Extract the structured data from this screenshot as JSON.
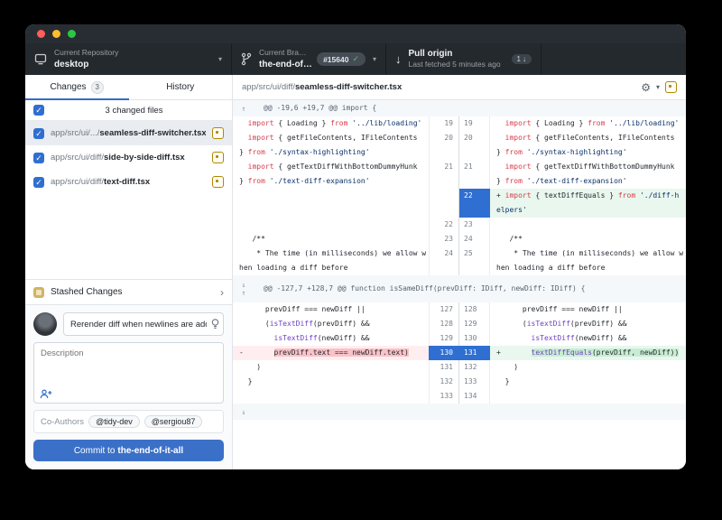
{
  "icons": {
    "caret": "▾",
    "check": "✓",
    "chevron_right": "›",
    "gear": "⚙",
    "arrow_down": "↓",
    "arrow_up": "↑",
    "checkmark": "✓"
  },
  "colors": {
    "accent_blue": "#316dca",
    "toolbar_bg": "#24292e",
    "selected_gutter": "#2f6fd1",
    "added_bg": "#e9f7ee",
    "removed_bg": "#ffeef0",
    "modified_icon": "#b08800",
    "keyword": "#d73a49",
    "string": "#0a3069",
    "function": "#6f42c1"
  },
  "toolbar": {
    "repo": {
      "label": "Current Repository",
      "value": "desktop"
    },
    "branch": {
      "label": "Current Bra…",
      "value": "the-end-of…",
      "badge": "#15640"
    },
    "pull": {
      "title": "Pull origin",
      "subtitle": "Last fetched 5 minutes ago",
      "badge_count": "1"
    }
  },
  "sidebar": {
    "tabs": {
      "changes": "Changes",
      "changes_badge": "3",
      "history": "History"
    },
    "files_header": "3 changed files",
    "files": [
      {
        "prefix": "app/src/ui/.../",
        "name": "seamless-diff-switcher.tsx",
        "selected": true
      },
      {
        "prefix": "app/src/ui/diff/",
        "name": "side-by-side-diff.tsx",
        "selected": false
      },
      {
        "prefix": "app/src/ui/diff/",
        "name": "text-diff.tsx",
        "selected": false
      }
    ],
    "stashed": "Stashed Changes",
    "commit": {
      "summary_value": "Rerender diff when newlines are adde",
      "description_placeholder": "Description",
      "coauthors_label": "Co-Authors",
      "coauthors": [
        "@tidy-dev",
        "@sergiou87"
      ],
      "button_prefix": "Commit to ",
      "button_branch": "the-end-of-it-all"
    }
  },
  "diff": {
    "file_prefix": "app/src/ui/diff/",
    "file_name": "seamless-diff-switcher.tsx",
    "rows": [
      {
        "type": "hunk",
        "icons": [
          "up"
        ],
        "text": "@@ -19,6 +19,7 @@ import {"
      },
      {
        "type": "line",
        "l": {
          "num": "19",
          "segs": [
            {
              "t": "  "
            },
            {
              "t": "import",
              "c": "k"
            },
            {
              "t": " { Loading } "
            },
            {
              "t": "from",
              "c": "k"
            },
            {
              "t": " "
            },
            {
              "t": "'../lib/loading'",
              "c": "s"
            }
          ]
        },
        "r": {
          "num": "19",
          "segs": [
            {
              "t": "  "
            },
            {
              "t": "import",
              "c": "k"
            },
            {
              "t": " { Loading } "
            },
            {
              "t": "from",
              "c": "k"
            },
            {
              "t": " "
            },
            {
              "t": "'../lib/loading'",
              "c": "s"
            }
          ]
        }
      },
      {
        "type": "line",
        "l": {
          "num": "20",
          "segs": [
            {
              "t": "  "
            },
            {
              "t": "import",
              "c": "k"
            },
            {
              "t": " { getFileContents, IFileContents \n} "
            },
            {
              "t": "from",
              "c": "k"
            },
            {
              "t": " "
            },
            {
              "t": "'./syntax-highlighting'",
              "c": "s"
            }
          ]
        },
        "r": {
          "num": "20",
          "segs": [
            {
              "t": "  "
            },
            {
              "t": "import",
              "c": "k"
            },
            {
              "t": " { getFileContents, IFileContents \n} "
            },
            {
              "t": "from",
              "c": "k"
            },
            {
              "t": " "
            },
            {
              "t": "'./syntax-highlighting'",
              "c": "s"
            }
          ]
        }
      },
      {
        "type": "line",
        "l": {
          "num": "21",
          "segs": [
            {
              "t": "  "
            },
            {
              "t": "import",
              "c": "k"
            },
            {
              "t": " { getTextDiffWithBottomDummyHunk \n} "
            },
            {
              "t": "from",
              "c": "k"
            },
            {
              "t": " "
            },
            {
              "t": "'./text-diff-expansion'",
              "c": "s"
            }
          ]
        },
        "r": {
          "num": "21",
          "segs": [
            {
              "t": "  "
            },
            {
              "t": "import",
              "c": "k"
            },
            {
              "t": " { getTextDiffWithBottomDummyHunk \n} "
            },
            {
              "t": "from",
              "c": "k"
            },
            {
              "t": " "
            },
            {
              "t": "'./text-diff-expansion'",
              "c": "s"
            }
          ]
        }
      },
      {
        "type": "line",
        "l": {
          "num": "",
          "segs": []
        },
        "r": {
          "num": "22",
          "sel": true,
          "kind": "add",
          "segs": [
            {
              "t": "+ "
            },
            {
              "t": "import",
              "c": "k"
            },
            {
              "t": " { textDiffEquals } "
            },
            {
              "t": "from",
              "c": "k"
            },
            {
              "t": " "
            },
            {
              "t": "'./diff-h\nelpers'",
              "c": "s"
            }
          ]
        }
      },
      {
        "type": "line",
        "l": {
          "num": "22",
          "segs": []
        },
        "r": {
          "num": "23",
          "segs": []
        }
      },
      {
        "type": "line",
        "l": {
          "num": "23",
          "segs": [
            {
              "t": "   /**"
            }
          ]
        },
        "r": {
          "num": "24",
          "segs": [
            {
              "t": "   /**"
            }
          ]
        }
      },
      {
        "type": "line",
        "l": {
          "num": "24",
          "segs": [
            {
              "t": "    * The time (in milliseconds) we allow w\nhen loading a diff before"
            }
          ]
        },
        "r": {
          "num": "25",
          "segs": [
            {
              "t": "    * The time (in milliseconds) we allow w\nhen loading a diff before"
            }
          ]
        }
      },
      {
        "type": "hunk",
        "icons": [
          "down",
          "up"
        ],
        "text": "@@ -127,7 +128,7 @@ function isSameDiff(prevDiff: IDiff, newDiff: IDiff) {"
      },
      {
        "type": "line",
        "l": {
          "num": "127",
          "segs": [
            {
              "t": "      prevDiff === newDiff ||"
            }
          ]
        },
        "r": {
          "num": "128",
          "segs": [
            {
              "t": "      prevDiff === newDiff ||"
            }
          ]
        }
      },
      {
        "type": "line",
        "l": {
          "num": "128",
          "segs": [
            {
              "t": "      ("
            },
            {
              "t": "isTextDiff",
              "c": "f"
            },
            {
              "t": "(prevDiff) &&"
            }
          ]
        },
        "r": {
          "num": "129",
          "segs": [
            {
              "t": "      ("
            },
            {
              "t": "isTextDiff",
              "c": "f"
            },
            {
              "t": "(prevDiff) &&"
            }
          ]
        }
      },
      {
        "type": "line",
        "l": {
          "num": "129",
          "segs": [
            {
              "t": "        "
            },
            {
              "t": "isTextDiff",
              "c": "f"
            },
            {
              "t": "(newDiff) &&"
            }
          ]
        },
        "r": {
          "num": "130",
          "segs": [
            {
              "t": "        "
            },
            {
              "t": "isTextDiff",
              "c": "f"
            },
            {
              "t": "(newDiff) &&"
            }
          ]
        }
      },
      {
        "type": "line",
        "l": {
          "num": "130",
          "sel": true,
          "kind": "del",
          "segs": [
            {
              "t": "-       "
            },
            {
              "t": "prevDiff.text === newDiff.text)",
              "c": "dh-seg"
            }
          ]
        },
        "r": {
          "num": "131",
          "sel": true,
          "kind": "add",
          "segs": [
            {
              "t": "+       "
            },
            {
              "t": "textDiffEquals",
              "c": "f ah"
            },
            {
              "t": "(prevDiff, newDiff))",
              "c": "ah"
            }
          ]
        }
      },
      {
        "type": "line",
        "l": {
          "num": "131",
          "segs": [
            {
              "t": "    )"
            }
          ]
        },
        "r": {
          "num": "132",
          "segs": [
            {
              "t": "    )"
            }
          ]
        }
      },
      {
        "type": "line",
        "l": {
          "num": "132",
          "segs": [
            {
              "t": "  }"
            }
          ]
        },
        "r": {
          "num": "133",
          "segs": [
            {
              "t": "  }"
            }
          ]
        }
      },
      {
        "type": "line",
        "l": {
          "num": "133",
          "segs": []
        },
        "r": {
          "num": "134",
          "segs": []
        }
      },
      {
        "type": "expander",
        "icons": [
          "down"
        ],
        "text": ""
      }
    ]
  }
}
